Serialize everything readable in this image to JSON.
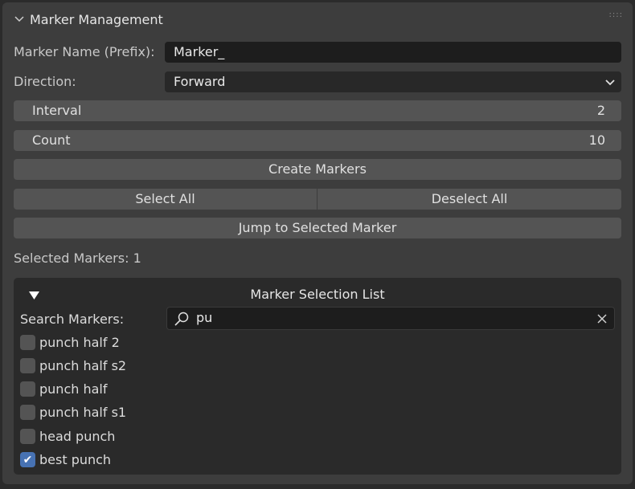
{
  "panel": {
    "title": "Marker Management"
  },
  "fields": {
    "name_label": "Marker Name (Prefix):",
    "name_value": "Marker_",
    "direction_label": "Direction:",
    "direction_value": "Forward"
  },
  "interval": {
    "label": "Interval",
    "value": "2"
  },
  "count": {
    "label": "Count",
    "value": "10"
  },
  "buttons": {
    "create": "Create Markers",
    "select_all": "Select All",
    "deselect_all": "Deselect All",
    "jump": "Jump to Selected Marker"
  },
  "status": "Selected Markers: 1",
  "list": {
    "title": "Marker Selection List",
    "search_label": "Search Markers:",
    "search_value": "pu",
    "items": [
      {
        "label": "punch half 2",
        "checked": false
      },
      {
        "label": "punch half s2",
        "checked": false
      },
      {
        "label": "punch half",
        "checked": false
      },
      {
        "label": "punch half s1",
        "checked": false
      },
      {
        "label": "head punch",
        "checked": false
      },
      {
        "label": "best punch",
        "checked": true
      }
    ]
  },
  "colors": {
    "accent": "#4772b3"
  }
}
